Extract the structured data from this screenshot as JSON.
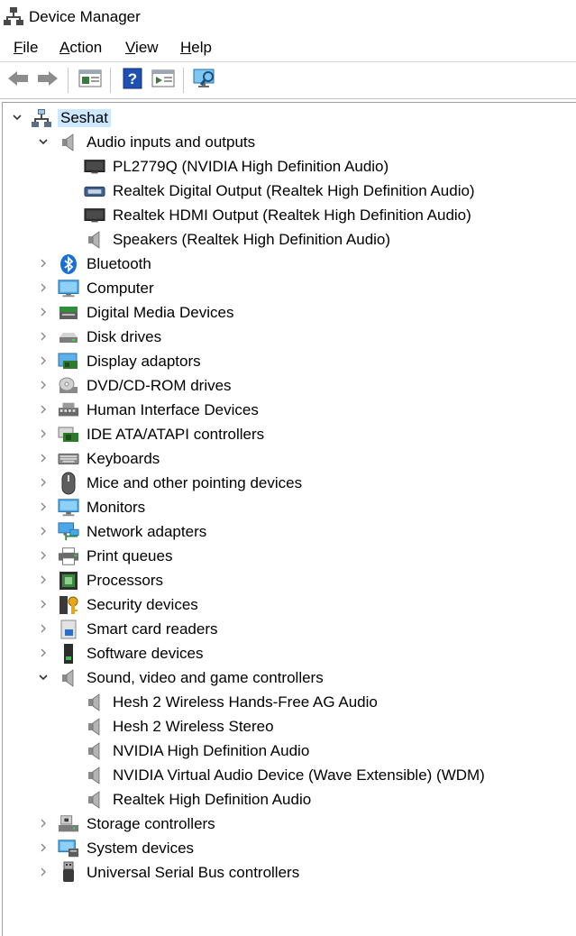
{
  "window": {
    "title": "Device Manager",
    "icon": "device-manager-icon"
  },
  "menubar": {
    "items": [
      {
        "label": "File",
        "accel": "F",
        "rest": "ile"
      },
      {
        "label": "Action",
        "accel": "A",
        "rest": "ction"
      },
      {
        "label": "View",
        "accel": "V",
        "rest": "iew"
      },
      {
        "label": "Help",
        "accel": "H",
        "rest": "elp"
      }
    ]
  },
  "toolbar": {
    "buttons": [
      "back-arrow-icon",
      "forward-arrow-icon",
      "properties-icon",
      "help-icon",
      "run-icon",
      "scan-hardware-icon"
    ]
  },
  "colors": {
    "selection": "#cce8ff",
    "accent": "#0078d7"
  },
  "tree": {
    "root": {
      "label": "Seshat",
      "icon": "computer-network-icon",
      "expanded": true,
      "selected": true
    },
    "categories": [
      {
        "label": "Audio inputs and outputs",
        "icon": "speaker-icon",
        "expanded": true,
        "children": [
          {
            "label": "PL2779Q (NVIDIA High Definition Audio)",
            "icon": "monitor-dark-icon"
          },
          {
            "label": "Realtek Digital Output (Realtek High Definition Audio)",
            "icon": "digital-output-icon"
          },
          {
            "label": "Realtek HDMI Output (Realtek High Definition Audio)",
            "icon": "monitor-dark-icon"
          },
          {
            "label": "Speakers (Realtek High Definition Audio)",
            "icon": "speaker-icon"
          }
        ]
      },
      {
        "label": "Bluetooth",
        "icon": "bluetooth-icon",
        "expanded": false
      },
      {
        "label": "Computer",
        "icon": "computer-icon",
        "expanded": false
      },
      {
        "label": "Digital Media Devices",
        "icon": "media-device-icon",
        "expanded": false
      },
      {
        "label": "Disk drives",
        "icon": "disk-drive-icon",
        "expanded": false
      },
      {
        "label": "Display adaptors",
        "icon": "display-adapter-icon",
        "expanded": false
      },
      {
        "label": "DVD/CD-ROM drives",
        "icon": "dvd-drive-icon",
        "expanded": false
      },
      {
        "label": "Human Interface Devices",
        "icon": "hid-icon",
        "expanded": false
      },
      {
        "label": "IDE ATA/ATAPI controllers",
        "icon": "ide-controller-icon",
        "expanded": false
      },
      {
        "label": "Keyboards",
        "icon": "keyboard-icon",
        "expanded": false
      },
      {
        "label": "Mice and other pointing devices",
        "icon": "mouse-icon",
        "expanded": false
      },
      {
        "label": "Monitors",
        "icon": "monitor-icon",
        "expanded": false
      },
      {
        "label": "Network adapters",
        "icon": "network-adapter-icon",
        "expanded": false
      },
      {
        "label": "Print queues",
        "icon": "printer-icon",
        "expanded": false
      },
      {
        "label": "Processors",
        "icon": "processor-icon",
        "expanded": false
      },
      {
        "label": "Security devices",
        "icon": "security-key-icon",
        "expanded": false
      },
      {
        "label": "Smart card readers",
        "icon": "smart-card-reader-icon",
        "expanded": false
      },
      {
        "label": "Software devices",
        "icon": "software-device-icon",
        "expanded": false
      },
      {
        "label": "Sound, video and game controllers",
        "icon": "speaker-icon",
        "expanded": true,
        "children": [
          {
            "label": "Hesh 2 Wireless Hands-Free AG Audio",
            "icon": "speaker-icon"
          },
          {
            "label": "Hesh 2 Wireless Stereo",
            "icon": "speaker-icon"
          },
          {
            "label": "NVIDIA High Definition Audio",
            "icon": "speaker-icon"
          },
          {
            "label": "NVIDIA Virtual Audio Device (Wave Extensible) (WDM)",
            "icon": "speaker-icon"
          },
          {
            "label": "Realtek High Definition Audio",
            "icon": "speaker-icon"
          }
        ]
      },
      {
        "label": "Storage controllers",
        "icon": "storage-controller-icon",
        "expanded": false
      },
      {
        "label": "System devices",
        "icon": "system-devices-icon",
        "expanded": false
      },
      {
        "label": "Universal Serial Bus controllers",
        "icon": "usb-icon",
        "expanded": false
      }
    ]
  }
}
